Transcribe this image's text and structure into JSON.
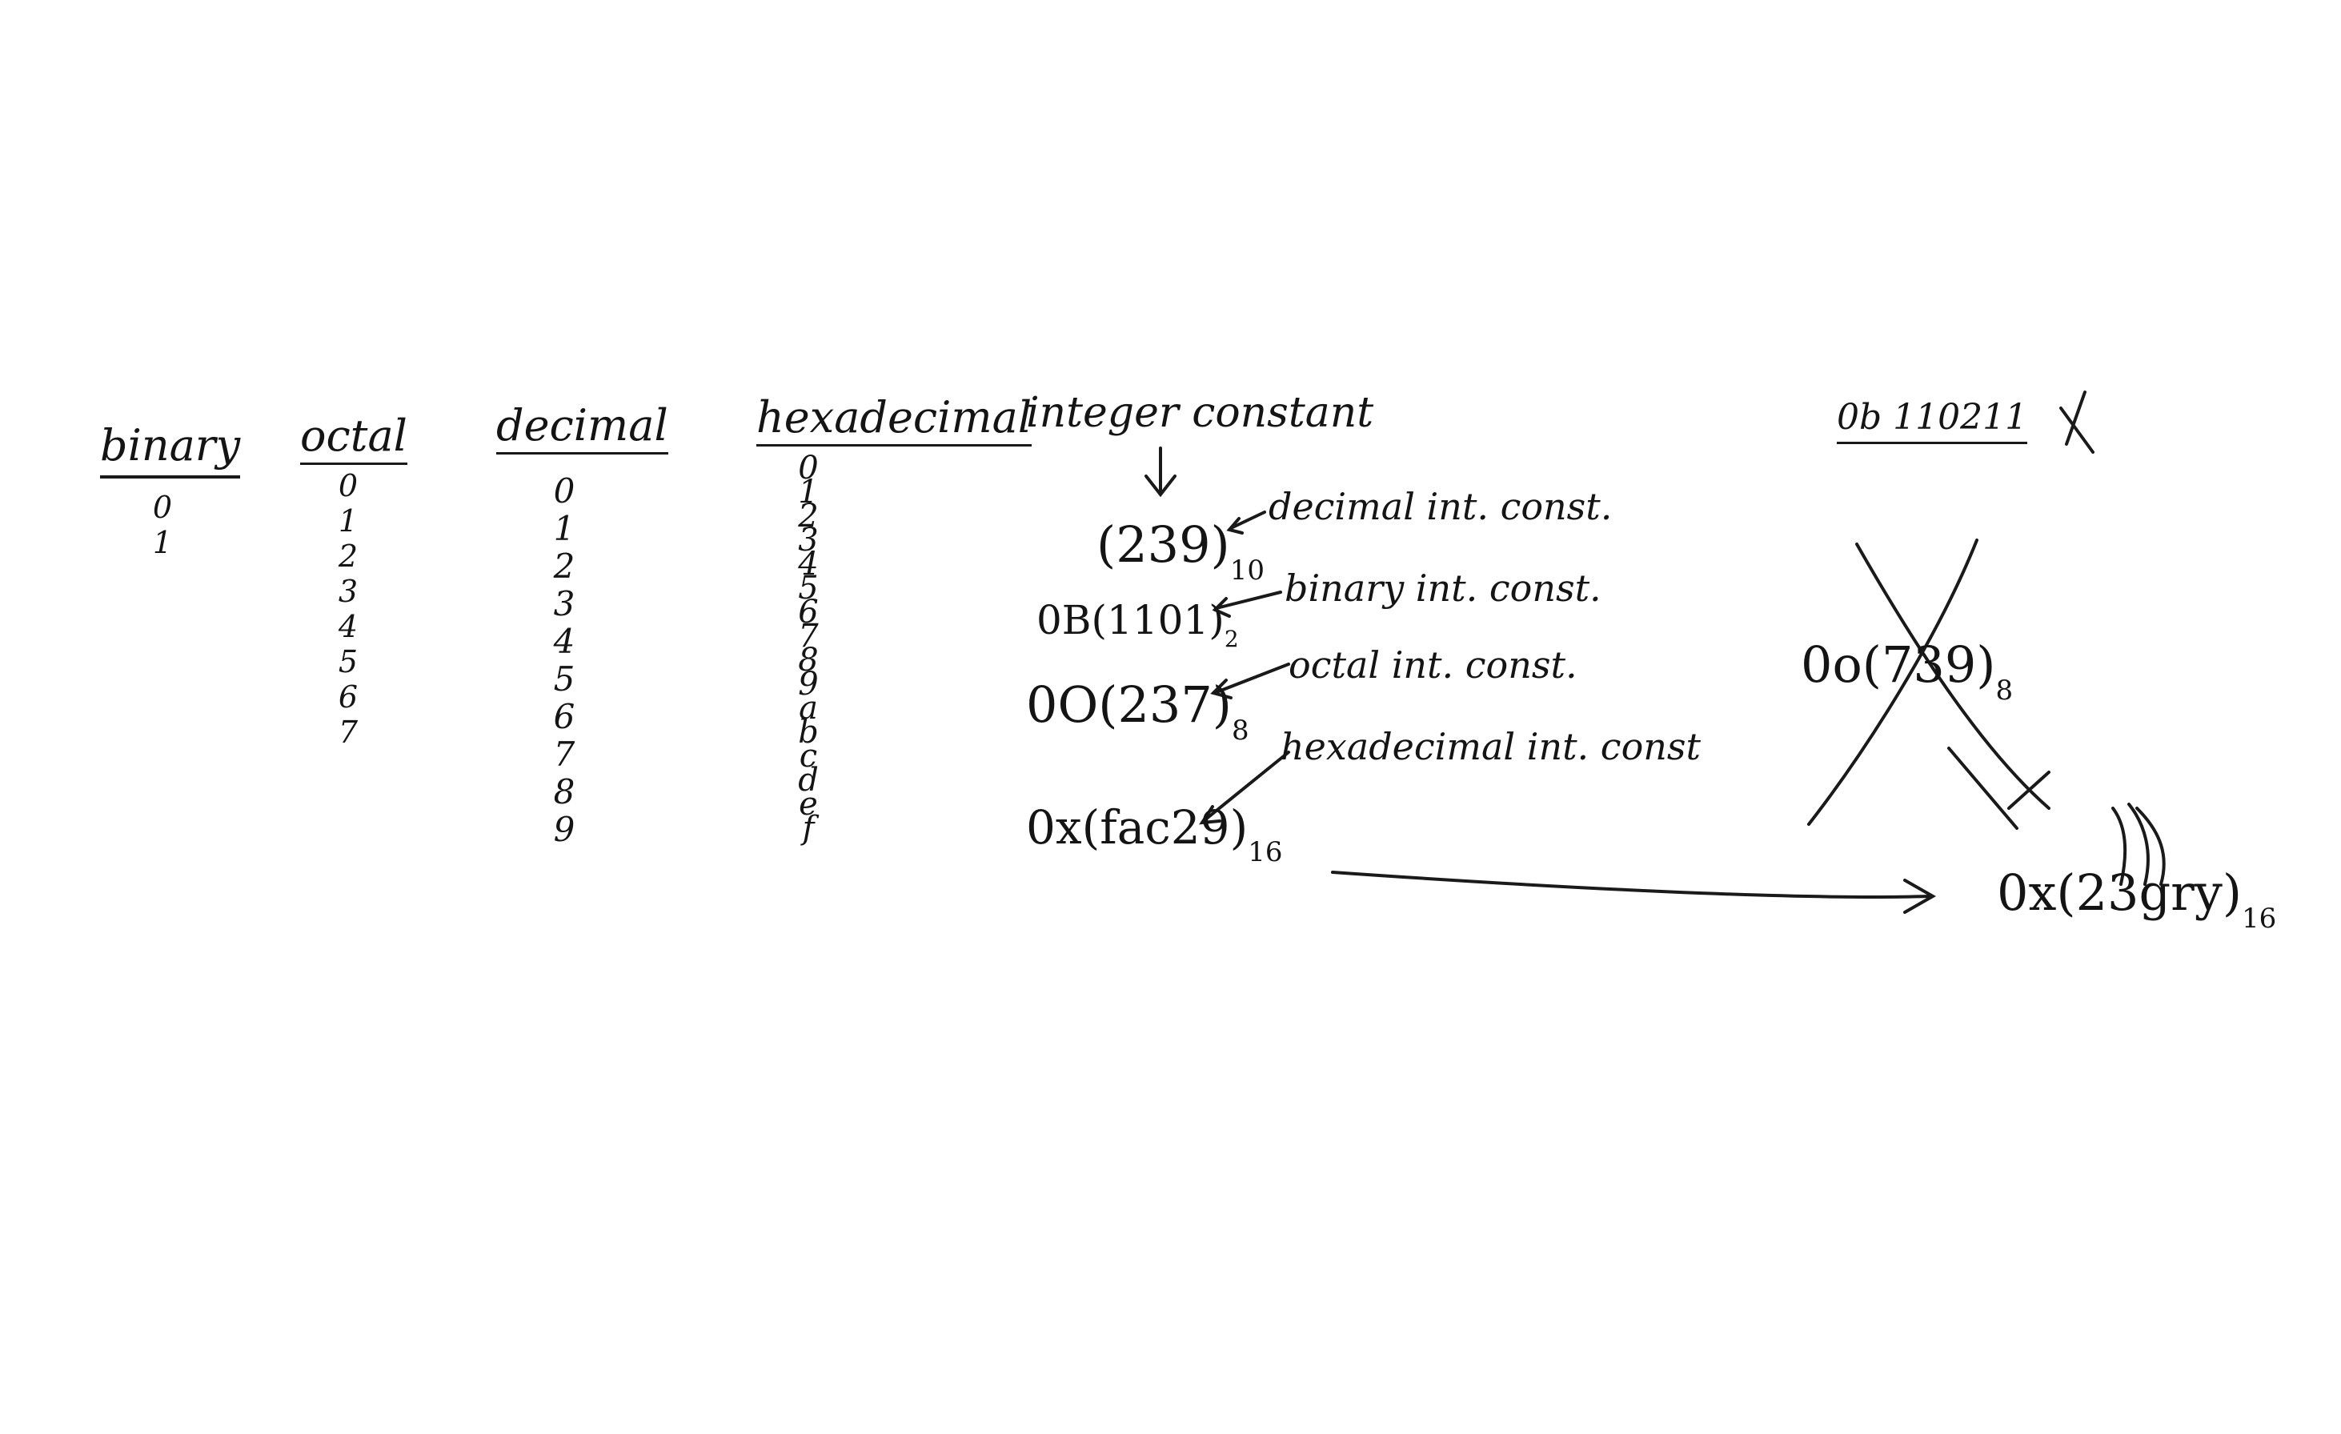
{
  "columns": {
    "binary": {
      "heading": "binary",
      "digits": [
        "0",
        "1"
      ]
    },
    "octal": {
      "heading": "octal",
      "digits": [
        "0",
        "1",
        "2",
        "3",
        "4",
        "5",
        "6",
        "7"
      ]
    },
    "decimal": {
      "heading": "decimal",
      "digits": [
        "0",
        "1",
        "2",
        "3",
        "4",
        "5",
        "6",
        "7",
        "8",
        "9"
      ]
    },
    "hexadecimal": {
      "heading": "hexadecimal",
      "digits": [
        "0",
        "1",
        "2",
        "3",
        "4",
        "5",
        "6",
        "7",
        "8",
        "9",
        "a",
        "b",
        "c",
        "d",
        "e",
        "f"
      ]
    }
  },
  "integer_constant": {
    "title": "integer constant",
    "examples": [
      {
        "value": "(239)",
        "base": "10",
        "label": "decimal int. const."
      },
      {
        "value": "0B(1101)",
        "base": "2",
        "label": "binary int. const."
      },
      {
        "value": "0O(237)",
        "base": "8",
        "label": "octal int. const."
      },
      {
        "value": "0x(fac29)",
        "base": "16",
        "label": "hexadecimal int. const"
      }
    ]
  },
  "invalid": [
    {
      "value": "0b 110211",
      "base": "",
      "mark": "X"
    },
    {
      "value": "0o(739)",
      "base": "8",
      "mark": "crossed-out"
    },
    {
      "value": "0x(23gry)",
      "base": "16",
      "mark": "arrows to invalid digits"
    }
  ]
}
